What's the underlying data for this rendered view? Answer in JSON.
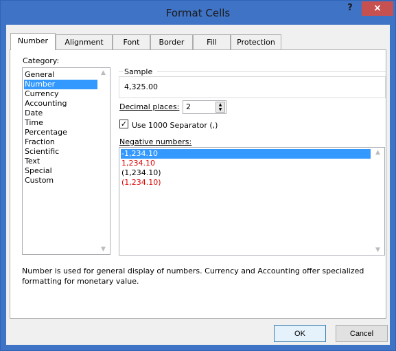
{
  "window": {
    "title": "Format Cells",
    "help": "?",
    "close": "×"
  },
  "tabs": [
    "Number",
    "Alignment",
    "Font",
    "Border",
    "Fill",
    "Protection"
  ],
  "category": {
    "label": "Category:",
    "items": [
      "General",
      "Number",
      "Currency",
      "Accounting",
      "Date",
      "Time",
      "Percentage",
      "Fraction",
      "Scientific",
      "Text",
      "Special",
      "Custom"
    ],
    "selected": "Number"
  },
  "sample": {
    "label": "Sample",
    "value": "4,325.00"
  },
  "decimal_places": {
    "label": "Decimal places:",
    "value": "2"
  },
  "separator": {
    "label": "Use 1000 Separator (,)",
    "checked": true
  },
  "negative_numbers": {
    "label": "Negative numbers:",
    "items": [
      "-1,234.10",
      "1,234.10",
      "(1,234.10)",
      "(1,234.10)"
    ],
    "red_items": [
      false,
      true,
      false,
      true
    ],
    "selected_index": 0
  },
  "description": "Number is used for general display of numbers.  Currency and Accounting offer specialized formatting for monetary value.",
  "buttons": {
    "ok": "OK",
    "cancel": "Cancel"
  },
  "colors": {
    "accent": "#3f73c5",
    "selection": "#3399ff",
    "negative_red": "#e00000",
    "close": "#c75050"
  }
}
